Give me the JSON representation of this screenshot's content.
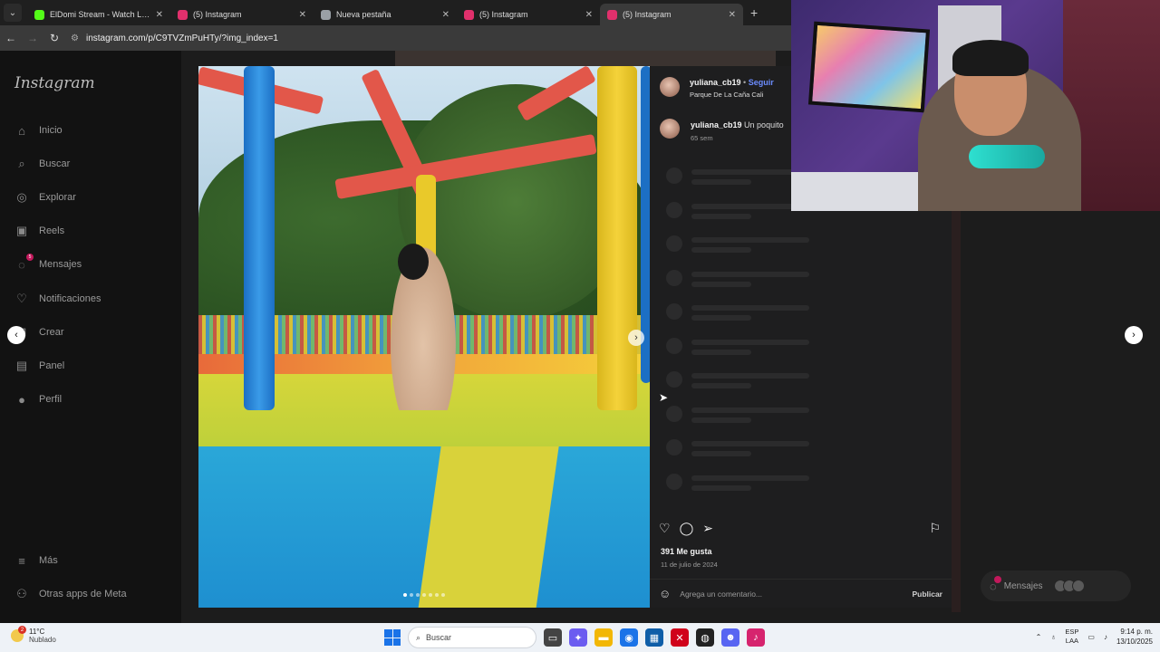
{
  "browser": {
    "tabs": [
      {
        "title": "ElDomi Stream - Watch Live on",
        "favicon_color": "#53fc18",
        "active": false
      },
      {
        "title": "(5) Instagram",
        "favicon_color": "#e1306c",
        "active": false
      },
      {
        "title": "Nueva pestaña",
        "favicon_color": "#9aa0a6",
        "active": false
      },
      {
        "title": "(5) Instagram",
        "favicon_color": "#e1306c",
        "active": false
      },
      {
        "title": "(5) Instagram",
        "favicon_color": "#e1306c",
        "active": true
      }
    ],
    "url": "instagram.com/p/C9TVZmPuHTy/?img_index=1"
  },
  "sidebar": {
    "logo": "Instagram",
    "items": [
      {
        "label": "Inicio",
        "icon": "home-icon",
        "glyph": "⌂"
      },
      {
        "label": "Buscar",
        "icon": "search-icon",
        "glyph": "⌕"
      },
      {
        "label": "Explorar",
        "icon": "compass-icon",
        "glyph": "◎"
      },
      {
        "label": "Reels",
        "icon": "reels-icon",
        "glyph": "▣"
      },
      {
        "label": "Mensajes",
        "icon": "messenger-icon",
        "glyph": "◌",
        "badge": "5"
      },
      {
        "label": "Notificaciones",
        "icon": "heart-icon",
        "glyph": "♡"
      },
      {
        "label": "Crear",
        "icon": "plus-square-icon",
        "glyph": "⊞"
      },
      {
        "label": "Panel",
        "icon": "chart-icon",
        "glyph": "▤"
      },
      {
        "label": "Perfil",
        "icon": "profile-icon",
        "glyph": "●"
      }
    ],
    "bottom_items": [
      {
        "label": "Más",
        "icon": "menu-icon",
        "glyph": "≡"
      },
      {
        "label": "Otras apps de Meta",
        "icon": "meta-icon",
        "glyph": "⚇"
      }
    ]
  },
  "post": {
    "username": "yuliana_cb19",
    "separator": "•",
    "follow_label": "Seguir",
    "location": "Parque De La Caña Cali",
    "caption_user": "yuliana_cb19",
    "caption_text": "Un poquito",
    "caption_age": "65 sem",
    "likes": "391 Me gusta",
    "date": "11 de julio de 2024",
    "comment_placeholder": "Agrega un comentario...",
    "publish_label": "Publicar",
    "carousel_count": 7,
    "carousel_index": 1
  },
  "floating_messages": {
    "label": "Mensajes",
    "badge": "5"
  },
  "taskbar": {
    "weather_temp": "11°C",
    "weather_desc": "Nublado",
    "weather_badge": "2",
    "search_placeholder": "Buscar",
    "lang_top": "ESP",
    "lang_bottom": "LAA",
    "time": "9:14 p. m.",
    "date": "13/10/2025"
  }
}
